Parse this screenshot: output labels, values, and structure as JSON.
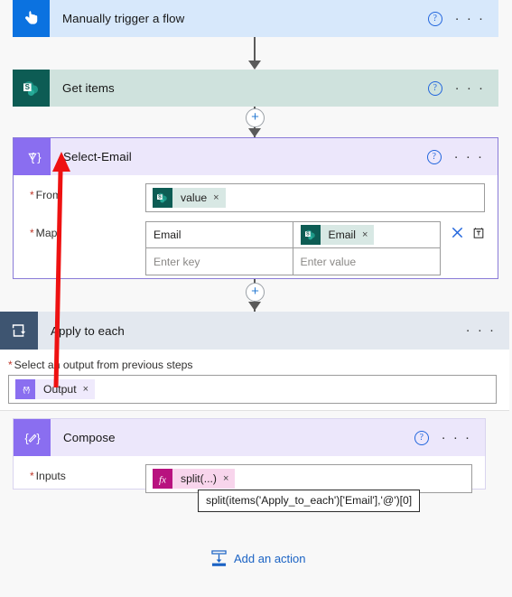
{
  "app": {
    "name": "Power Automate Flow Designer"
  },
  "nodes": [
    {
      "id": "manual-trigger",
      "title": "Manually trigger a flow",
      "icon": "hand-tap-icon",
      "icon_color": "#0b72e0",
      "bg": "#d7e8fb",
      "has_help": true,
      "has_menu": true
    },
    {
      "id": "get-items",
      "title": "Get items",
      "icon": "sharepoint-icon",
      "icon_color": "#0d5c54",
      "bg": "#cfe2dd",
      "has_help": true,
      "has_menu": true
    }
  ],
  "select_action": {
    "title": "Select-Email",
    "icon": "select-braces-icon",
    "icon_color": "#8a6ef0",
    "header_bg": "#ece7fb",
    "border_color": "#8a7bd8",
    "has_help": true,
    "has_menu": true,
    "from": {
      "label": "From",
      "required": true,
      "token": {
        "text": "value",
        "icon": "sharepoint-icon",
        "remove": "×"
      }
    },
    "map": {
      "label": "Map",
      "required": true,
      "rows": [
        {
          "key": "Email",
          "key_placeholder": "",
          "value_token": {
            "text": "Email",
            "icon": "sharepoint-icon",
            "remove": "×"
          },
          "value_placeholder": ""
        },
        {
          "key": "",
          "key_placeholder": "Enter key",
          "value_token": null,
          "value_placeholder": "Enter value"
        }
      ],
      "delete_icon": "close-x-icon",
      "switch_icon": "switch-to-text-mode-icon"
    }
  },
  "apply_to_each": {
    "title": "Apply to each",
    "icon": "loop-icon",
    "icon_color": "#3e5571",
    "header_bg": "#e3e8ef",
    "has_help": false,
    "has_menu": true,
    "field_label": "Select an output from previous steps",
    "field_required": true,
    "token": {
      "text": "Output",
      "icon": "select-braces-icon",
      "remove": "×"
    }
  },
  "compose_action": {
    "title": "Compose",
    "icon": "compose-pencil-icon",
    "icon_color": "#8a6ef0",
    "header_bg": "#ece7fb",
    "has_help": true,
    "has_menu": true,
    "inputs": {
      "label": "Inputs",
      "required": true,
      "token": {
        "text": "split(...)",
        "icon": "fx-icon",
        "remove": "×"
      }
    }
  },
  "tooltip": {
    "text": "split(items('Apply_to_each')['Email'],'@')[0]"
  },
  "add_action": {
    "label": "Add an action",
    "icon": "insert-action-icon",
    "color": "#1b63c4"
  },
  "connectors": [
    {
      "id": "trigger-to-getitems",
      "has_plus": false
    },
    {
      "id": "getitems-to-select",
      "has_plus": true,
      "plus_label": "+"
    },
    {
      "id": "select-to-apply",
      "has_plus": true,
      "plus_label": "+"
    }
  ],
  "annotation": {
    "type": "arrow",
    "color": "#ee1111",
    "from": "output-token-chip",
    "to": "select-email-title"
  },
  "glyphs": {
    "help": "?",
    "ellipsis": "· · ·",
    "plus": "+",
    "close": "×"
  }
}
